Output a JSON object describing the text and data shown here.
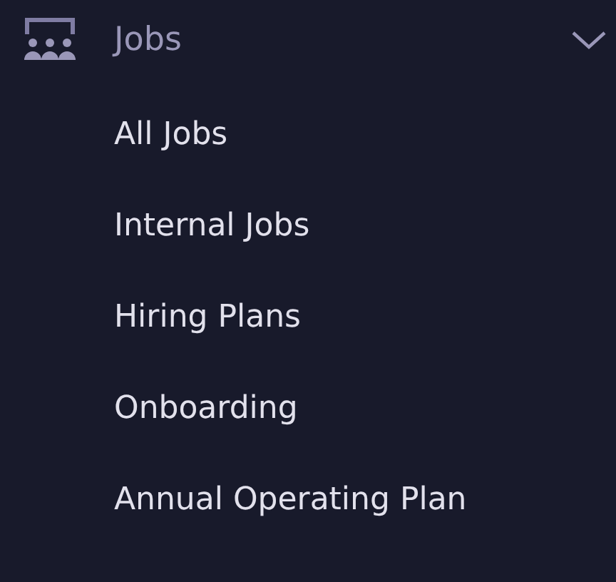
{
  "section": {
    "title": "Jobs",
    "expanded": true,
    "items": [
      {
        "label": "All Jobs"
      },
      {
        "label": "Internal Jobs"
      },
      {
        "label": "Hiring Plans"
      },
      {
        "label": "Onboarding"
      },
      {
        "label": "Annual Operating Plan"
      }
    ]
  }
}
